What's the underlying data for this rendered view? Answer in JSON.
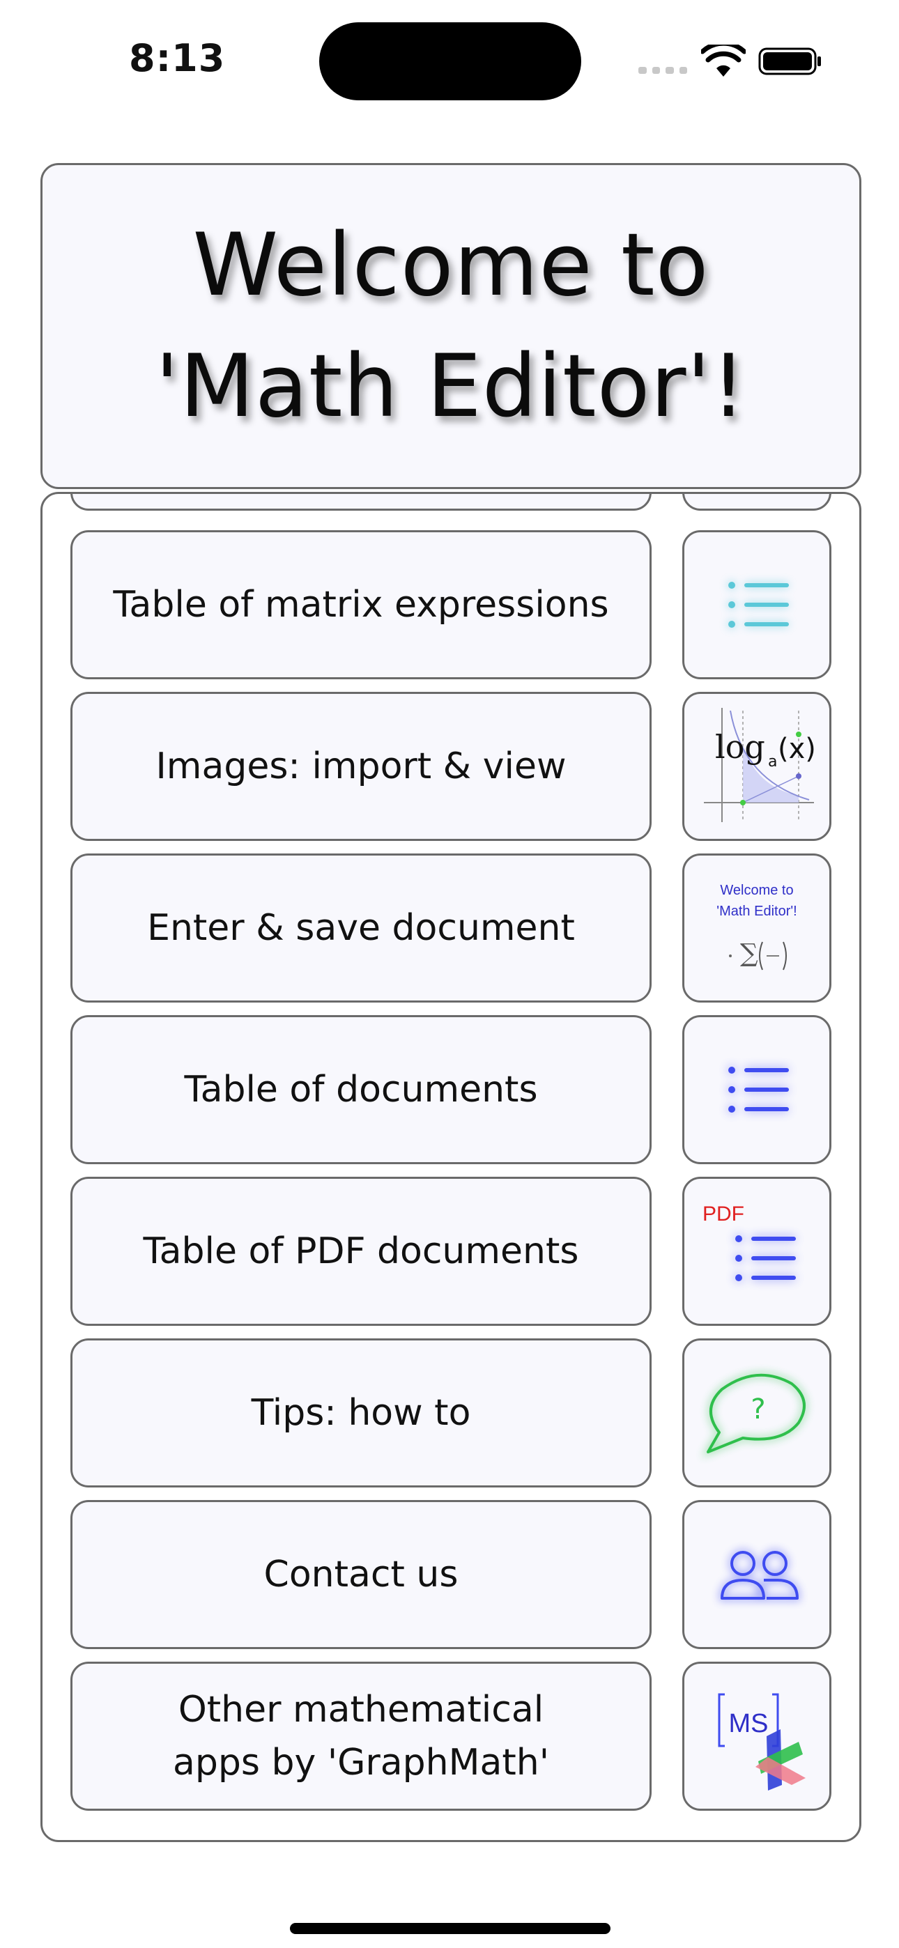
{
  "status_bar": {
    "time": "8:13"
  },
  "header": {
    "title": "Welcome to\n'Math Editor'!"
  },
  "menu": [
    {
      "label": "",
      "icon": "partial-row",
      "partial": true
    },
    {
      "label": "Table of matrix expressions",
      "icon": "list-icon",
      "color": "#5bc8d8"
    },
    {
      "label": "Images: import & view",
      "icon": "log-graph-icon"
    },
    {
      "label": "Enter & save document",
      "icon": "document-preview-icon"
    },
    {
      "label": "Table of documents",
      "icon": "list-icon",
      "color": "#3f4cf0"
    },
    {
      "label": "Table of PDF documents",
      "icon": "pdf-list-icon",
      "color": "#3f4cf0"
    },
    {
      "label": "Tips: how to",
      "icon": "question-bubble-icon",
      "color": "#2fbf4c"
    },
    {
      "label": "Contact us",
      "icon": "people-icon",
      "color": "#3f4cf0"
    },
    {
      "label": "Other mathematical\napps by 'GraphMath'",
      "icon": "graphmath-logo-icon"
    }
  ],
  "icons": {
    "log_label": "log",
    "log_sub": "a",
    "log_arg": "(x)",
    "pdf_label": "PDF",
    "question_mark": "?",
    "doc_line1": "Welcome to",
    "doc_line2": "'Math Editor'!",
    "ms_label": "MS"
  }
}
